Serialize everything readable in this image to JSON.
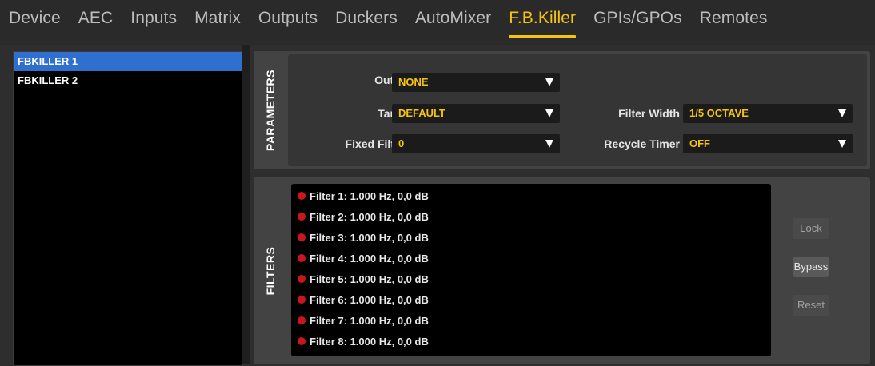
{
  "nav": {
    "tabs": [
      {
        "label": "Device"
      },
      {
        "label": "AEC"
      },
      {
        "label": "Inputs"
      },
      {
        "label": "Matrix"
      },
      {
        "label": "Outputs"
      },
      {
        "label": "Duckers"
      },
      {
        "label": "AutoMixer"
      },
      {
        "label": "F.B.Killer"
      },
      {
        "label": "GPIs/GPOs"
      },
      {
        "label": "Remotes"
      }
    ],
    "active": "F.B.Killer"
  },
  "list": {
    "items": [
      {
        "label": "FBKILLER 1"
      },
      {
        "label": "FBKILLER 2"
      }
    ],
    "selected": "FBKILLER 1"
  },
  "parameters": {
    "title": "PARAMETERS",
    "output": {
      "label": "Output",
      "value": "NONE"
    },
    "target": {
      "label": "Target",
      "value": "DEFAULT"
    },
    "fixed_filters": {
      "label": "Fixed Filters",
      "value": "0"
    },
    "filter_width": {
      "label": "Filter Width",
      "value": "1/5 OCTAVE"
    },
    "recycle_timer": {
      "label": "Recycle Timer",
      "value": "OFF"
    }
  },
  "filters": {
    "title": "FILTERS",
    "items": [
      {
        "text": "Filter 1: 1.000 Hz, 0,0 dB"
      },
      {
        "text": "Filter 2: 1.000 Hz, 0,0 dB"
      },
      {
        "text": "Filter 3: 1.000 Hz, 0,0 dB"
      },
      {
        "text": "Filter 4: 1.000 Hz, 0,0 dB"
      },
      {
        "text": "Filter 5: 1.000 Hz, 0,0 dB"
      },
      {
        "text": "Filter 6: 1.000 Hz, 0,0 dB"
      },
      {
        "text": "Filter 7: 1.000 Hz, 0,0 dB"
      },
      {
        "text": "Filter 8: 1.000 Hz, 0,0 dB"
      }
    ],
    "buttons": {
      "lock": "Lock",
      "bypass": "Bypass",
      "reset": "Reset"
    }
  },
  "colors": {
    "accent": "#f6c40e",
    "selection": "#2e6fd0",
    "filter_dot": "#c8161c"
  }
}
